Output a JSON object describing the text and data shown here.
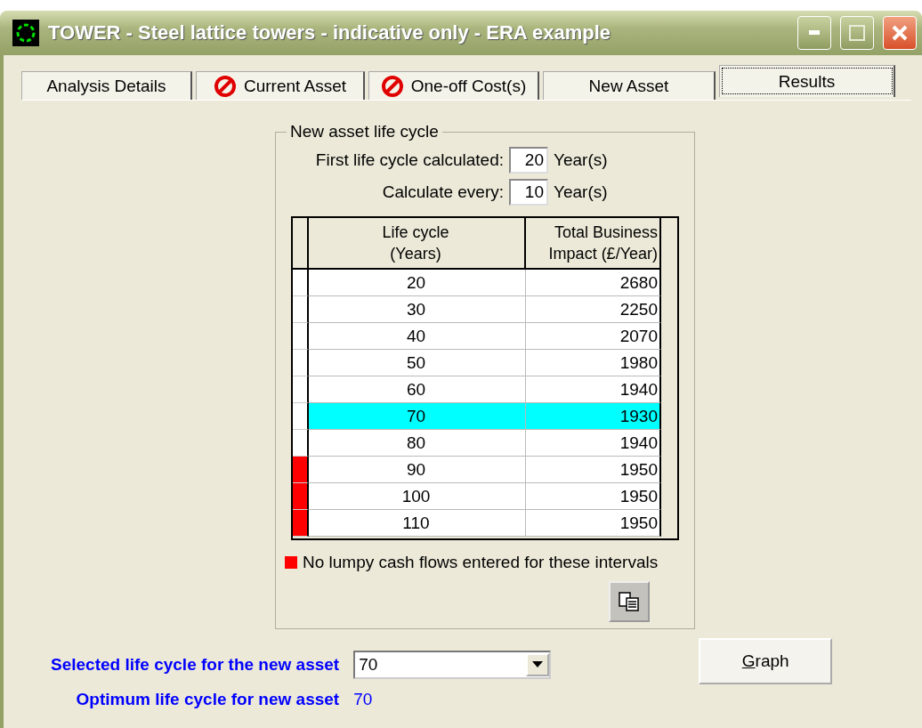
{
  "window": {
    "title": "TOWER - Steel lattice towers - indicative only - ERA example"
  },
  "tabs": [
    {
      "label": "Analysis Details",
      "selected": false,
      "warning": false
    },
    {
      "label": "Current Asset",
      "selected": false,
      "warning": true
    },
    {
      "label": "One-off Cost(s)",
      "selected": false,
      "warning": true
    },
    {
      "label": "New Asset",
      "selected": false,
      "warning": false
    },
    {
      "label": "Results",
      "selected": true,
      "warning": false
    }
  ],
  "group": {
    "title": "New asset life cycle",
    "fields": [
      {
        "label": "First life cycle calculated:",
        "value": "20",
        "unit": "Year(s)"
      },
      {
        "label": "Calculate every:",
        "value": "10",
        "unit": "Year(s)"
      }
    ],
    "table": {
      "columns": [
        "Life cycle\n(Years)",
        "Total Business\nImpact (£/Year)"
      ],
      "rows": [
        {
          "cells": [
            "20",
            "2680"
          ],
          "flagged": false,
          "selected": false
        },
        {
          "cells": [
            "30",
            "2250"
          ],
          "flagged": false,
          "selected": false
        },
        {
          "cells": [
            "40",
            "2070"
          ],
          "flagged": false,
          "selected": false
        },
        {
          "cells": [
            "50",
            "1980"
          ],
          "flagged": false,
          "selected": false
        },
        {
          "cells": [
            "60",
            "1940"
          ],
          "flagged": false,
          "selected": false
        },
        {
          "cells": [
            "70",
            "1930"
          ],
          "flagged": false,
          "selected": true
        },
        {
          "cells": [
            "80",
            "1940"
          ],
          "flagged": false,
          "selected": false
        },
        {
          "cells": [
            "90",
            "1950"
          ],
          "flagged": true,
          "selected": false
        },
        {
          "cells": [
            "100",
            "1950"
          ],
          "flagged": true,
          "selected": false
        },
        {
          "cells": [
            "110",
            "1950"
          ],
          "flagged": true,
          "selected": false
        }
      ]
    },
    "legend": "No lumpy cash flows entered for these intervals"
  },
  "selected_life_cycle": {
    "label": "Selected life cycle for the new asset",
    "value": "70"
  },
  "optimum": {
    "label": "Optimum life cycle for new asset",
    "value": "70"
  },
  "graph_button": "Graph"
}
